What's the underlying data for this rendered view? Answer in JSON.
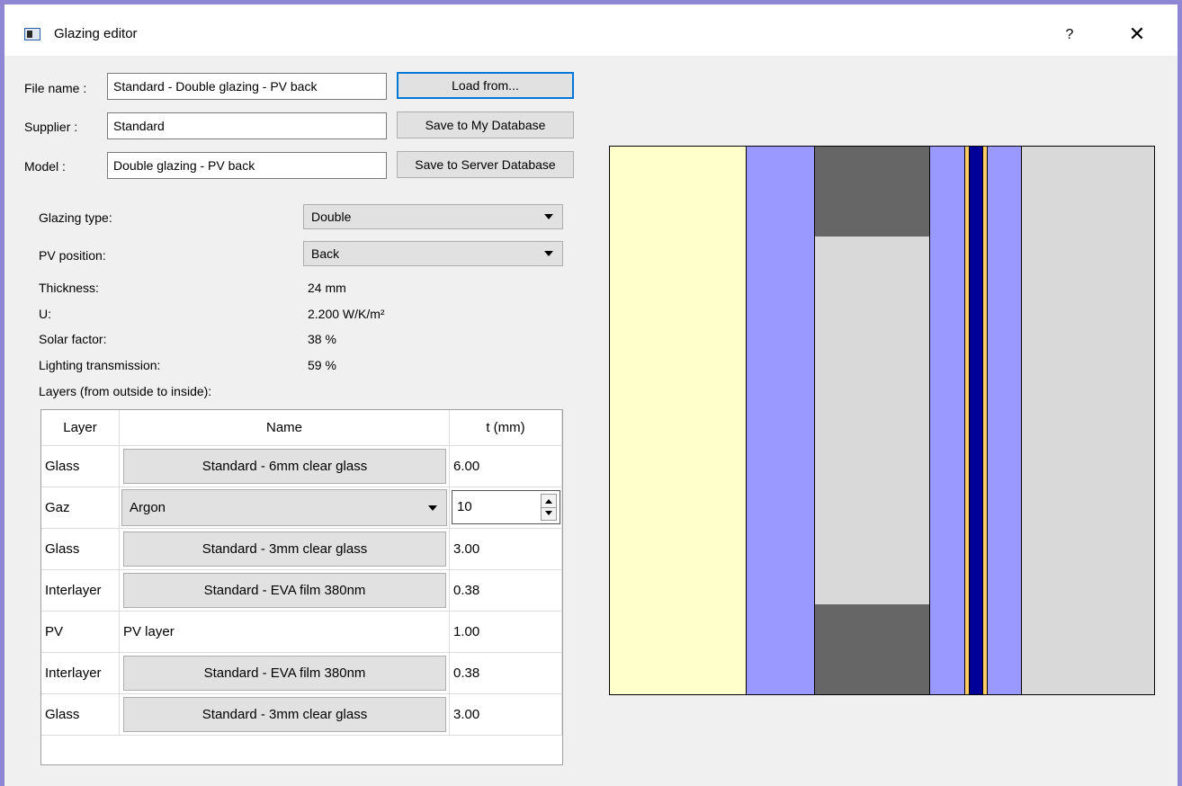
{
  "window": {
    "title": "Glazing editor",
    "help_symbol": "?",
    "close_symbol": "✕"
  },
  "form": {
    "file_name_label": "File name :",
    "file_name_value": "Standard - Double glazing - PV back",
    "supplier_label": "Supplier :",
    "supplier_value": "Standard",
    "model_label": "Model :",
    "model_value": "Double glazing - PV back",
    "load_button": "Load from...",
    "save_my_db_button": "Save to My Database",
    "save_server_db_button": "Save to Server Database"
  },
  "properties": {
    "glazing_type_label": "Glazing type:",
    "glazing_type_value": "Double",
    "pv_position_label": "PV position:",
    "pv_position_value": "Back",
    "thickness_label": "Thickness:",
    "thickness_value": "24 mm",
    "u_label": "U:",
    "u_value": "2.200 W/K/m²",
    "solar_factor_label": "Solar factor:",
    "solar_factor_value": "38 %",
    "lighting_label": "Lighting transmission:",
    "lighting_value": "59 %",
    "layers_label": "Layers (from outside to inside):"
  },
  "layers_table": {
    "headers": [
      "Layer",
      "Name",
      "t (mm)"
    ],
    "rows": [
      {
        "layer": "Glass",
        "name": "Standard - 6mm clear glass",
        "t": "6.00",
        "kind": "button"
      },
      {
        "layer": "Gaz",
        "name": "Argon",
        "t": "10",
        "kind": "combo"
      },
      {
        "layer": "Glass",
        "name": "Standard - 3mm clear glass",
        "t": "3.00",
        "kind": "button"
      },
      {
        "layer": "Interlayer",
        "name": "Standard - EVA film 380nm",
        "t": "0.38",
        "kind": "button"
      },
      {
        "layer": "PV",
        "name": "PV layer",
        "t": "1.00",
        "kind": "text"
      },
      {
        "layer": "Interlayer",
        "name": "Standard - EVA film 380nm",
        "t": "0.38",
        "kind": "button"
      },
      {
        "layer": "Glass",
        "name": "Standard - 3mm clear glass",
        "t": "3.00",
        "kind": "button"
      }
    ]
  },
  "diagram": {
    "colors": {
      "outside": "#ffffcc",
      "glass": "#9999ff",
      "gas": "#d9d9d9",
      "gas_spacer": "#666666",
      "interlayer": "#ffcc66",
      "pv": "#000099",
      "inside": "#d9d9d9"
    }
  }
}
